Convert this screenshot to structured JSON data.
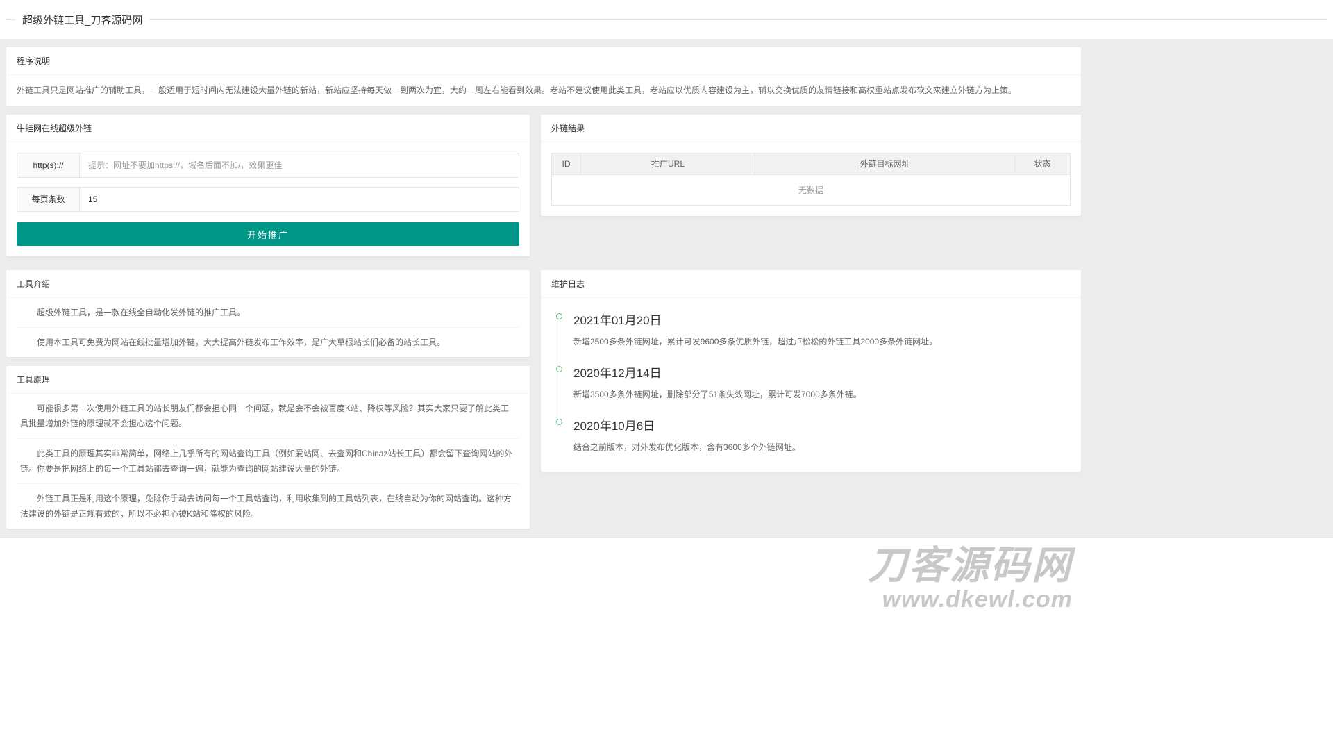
{
  "page": {
    "title": "超级外链工具_刀客源码网"
  },
  "program_note": {
    "header": "程序说明",
    "content": "外链工具只是网站推广的辅助工具，一般适用于短时间内无法建设大量外链的新站，新站应坚持每天做一到两次为宜，大约一周左右能看到效果。老站不建议使用此类工具，老站应以优质内容建设为主，辅以交换优质的友情链接和高权重站点发布软文来建立外链方为上策。"
  },
  "promo_form": {
    "header": "牛蛙网在线超级外链",
    "url_label": "http(s)://",
    "url_placeholder": "提示：网址不要加https://，域名后面不加/，效果更佳",
    "per_page_label": "每页条数",
    "per_page_value": "15",
    "submit_label": "开始推广"
  },
  "results": {
    "header": "外链结果",
    "columns": [
      "ID",
      "推广URL",
      "外链目标网址",
      "状态"
    ],
    "empty_text": "无数据"
  },
  "tool_intro": {
    "header": "工具介绍",
    "paragraphs": [
      "超级外链工具，是一款在线全自动化发外链的推广工具。",
      "使用本工具可免费为网站在线批量增加外链，大大提高外链发布工作效率，是广大草根站长们必备的站长工具。"
    ]
  },
  "tool_principle": {
    "header": "工具原理",
    "paragraphs": [
      "可能很多第一次使用外链工具的站长朋友们都会担心同一个问题，就是会不会被百度K站、降权等风险？其实大家只要了解此类工具批量增加外链的原理就不会担心这个问题。",
      "此类工具的原理其实非常简单，网络上几乎所有的网站查询工具（例如爱站网、去查网和Chinaz站长工具）都会留下查询网站的外链。你要是把网络上的每一个工具站都去查询一遍，就能为查询的网站建设大量的外链。",
      "外链工具正是利用这个原理，免除你手动去访问每一个工具站查询，利用收集到的工具站列表，在线自动为你的网站查询。这种方法建设的外链是正规有效的，所以不必担心被K站和降权的风险。"
    ]
  },
  "maintenance_log": {
    "header": "维护日志",
    "entries": [
      {
        "date": "2021年01月20日",
        "desc": "新增2500多条外链网址，累计可发9600多条优质外链，超过卢松松的外链工具2000多条外链网址。"
      },
      {
        "date": "2020年12月14日",
        "desc": "新增3500多条外链网址，删除部分了51条失效网址，累计可发7000多条外链。"
      },
      {
        "date": "2020年10月6日",
        "desc": "结合之前版本，对外发布优化版本，含有3600多个外链网址。"
      }
    ]
  },
  "watermark": {
    "line1": "刀客源码网",
    "line2": "www.dkewl.com"
  },
  "colors": {
    "accent": "#009688",
    "timeline_dot": "#5FB878",
    "page_bg": "#ececec"
  }
}
